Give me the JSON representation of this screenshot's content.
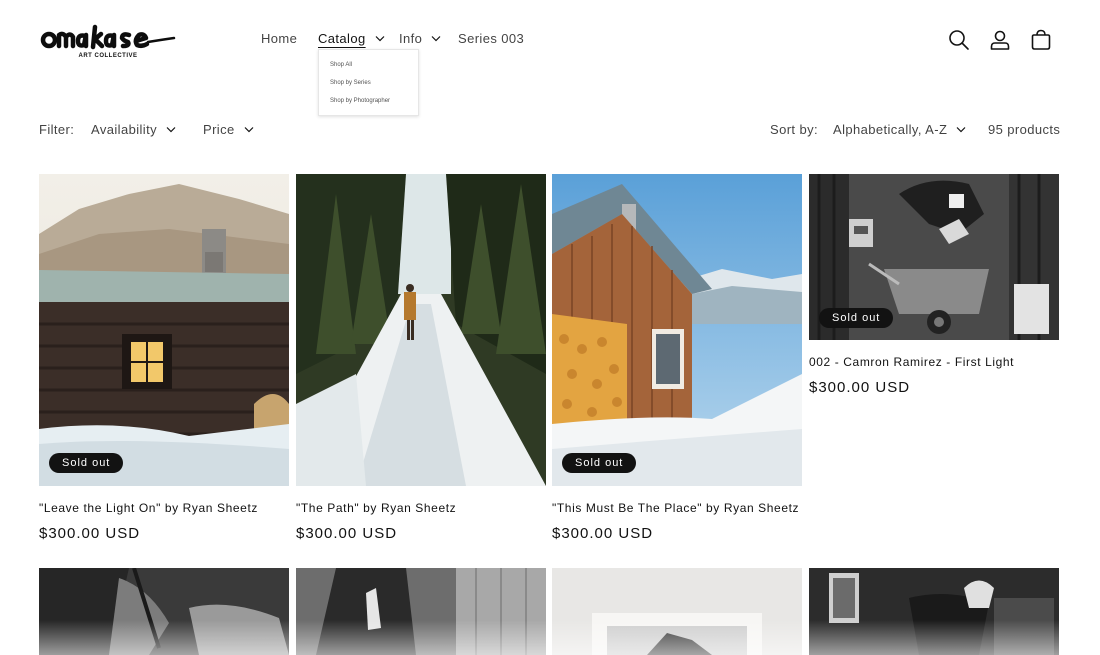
{
  "brand": {
    "wordmark": "omakase",
    "subtitle": "ART COLLECTIVE"
  },
  "nav": {
    "home": "Home",
    "catalog": "Catalog",
    "info": "Info",
    "series": "Series 003"
  },
  "catalog_menu": [
    "Shop All",
    "Shop by Series",
    "Shop by Photographer"
  ],
  "filters": {
    "label": "Filter:",
    "availability": "Availability",
    "price": "Price",
    "sort_label": "Sort by:",
    "sort_value": "Alphabetically, A-Z",
    "count": "95 products"
  },
  "products": [
    {
      "title": "\"Leave the Light On\" by Ryan Sheetz",
      "price": "$300.00 USD",
      "badge": "Sold out"
    },
    {
      "title": "\"The Path\" by Ryan Sheetz",
      "price": "$300.00 USD",
      "badge": ""
    },
    {
      "title": "\"This Must Be The Place\" by Ryan Sheetz",
      "price": "$300.00 USD",
      "badge": "Sold out"
    },
    {
      "title": "002 - Camron Ramirez - First Light",
      "price": "$300.00 USD",
      "badge": "Sold out"
    }
  ],
  "icons": {
    "search": "search-icon",
    "account": "account-icon",
    "cart": "cart-icon",
    "chevron": "chevron-down-icon"
  },
  "colors": {
    "text": "#121212",
    "badge_bg": "#121212",
    "background": "#ffffff"
  }
}
